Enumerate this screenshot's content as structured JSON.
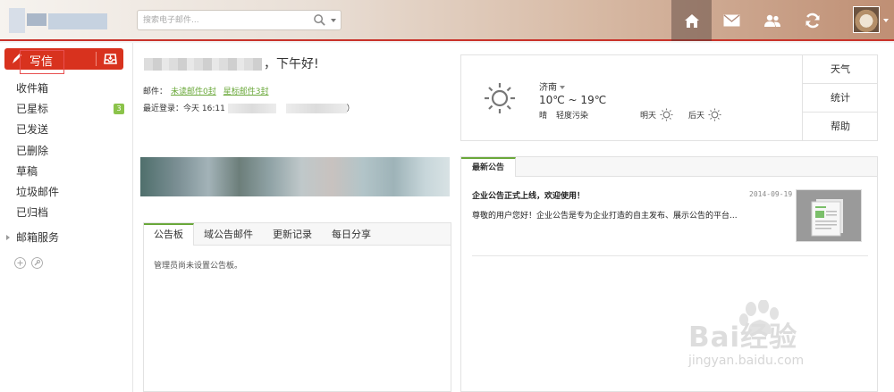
{
  "search": {
    "placeholder": "搜索电子邮件..."
  },
  "sidebar": {
    "compose_label": "写信",
    "folders": [
      {
        "label": "收件箱"
      },
      {
        "label": "已星标",
        "badge": "3"
      },
      {
        "label": "已发送"
      },
      {
        "label": "已删除"
      },
      {
        "label": "草稿"
      },
      {
        "label": "垃圾邮件"
      },
      {
        "label": "已归档"
      }
    ],
    "services_label": "邮箱服务"
  },
  "main": {
    "greeting": "，下午好!",
    "mail_label": "邮件：",
    "unread_link": "未读邮件0封",
    "starred_link": "星标邮件3封",
    "last_login_label": "最近登录：今天 16:11",
    "last_login_suffix": "）",
    "board": {
      "tabs": [
        "公告板",
        "域公告邮件",
        "更新记录",
        "每日分享"
      ],
      "empty_text": "管理员尚未设置公告板。"
    }
  },
  "weather": {
    "city": "济南",
    "temp": "10℃ ~ 19℃",
    "condition": "晴",
    "air": "轻度污染",
    "tomorrow_label": "明天",
    "after_label": "后天",
    "tabs": [
      "天气",
      "统计",
      "帮助"
    ]
  },
  "notice": {
    "tab": "最新公告",
    "title": "企业公告正式上线，欢迎使用！",
    "date": "2014-09-19",
    "desc": "尊敬的用户您好！企业公告是专为企业打造的自主发布、展示公告的平台..."
  },
  "watermark": {
    "main": "Bai经验",
    "sub": "jingyan.baidu.com"
  },
  "colors": {
    "accent_red": "#d8321e",
    "accent_green": "#6aa83a"
  }
}
